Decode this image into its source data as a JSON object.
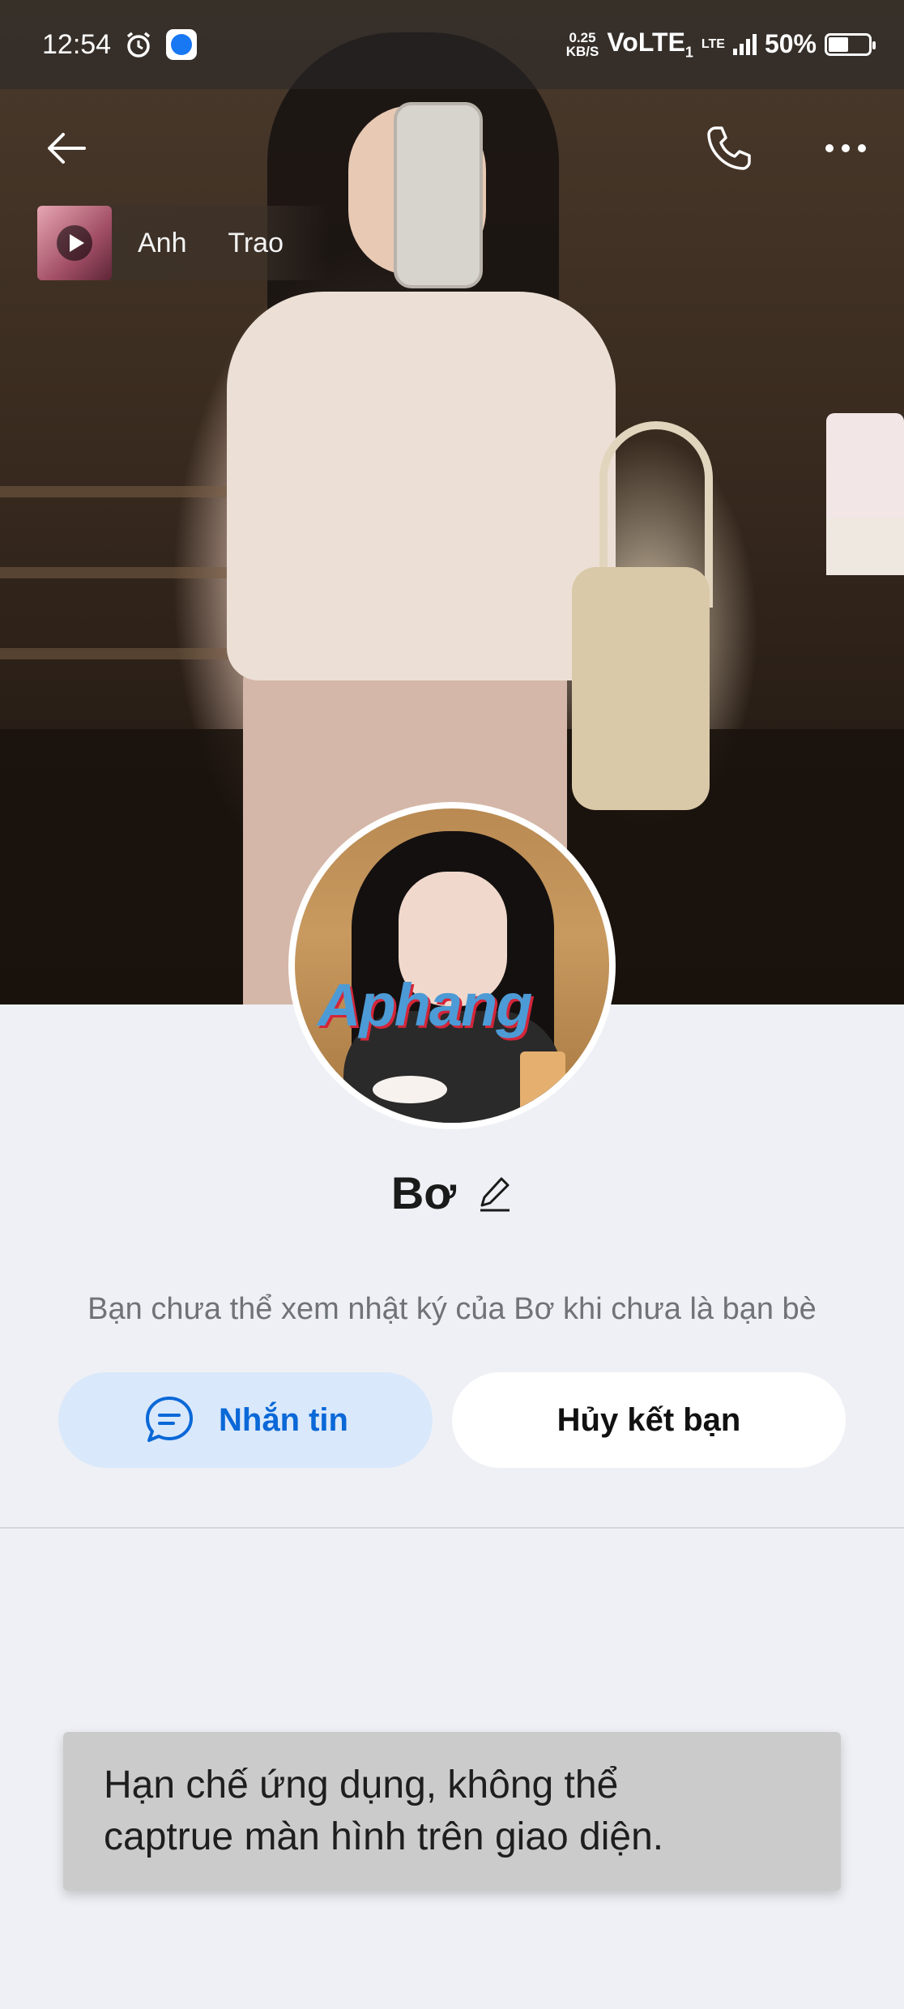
{
  "status_bar": {
    "time": "12:54",
    "net_speed_value": "0.25",
    "net_speed_unit": "KB/S",
    "network": "VoLTE",
    "network_sub": "1",
    "lte": "LTE",
    "battery": "50%",
    "battery_level": 0.5
  },
  "header": {
    "back_icon": "arrow-left-icon",
    "call_icon": "phone-icon",
    "more_icon": "more-dots-icon"
  },
  "music": {
    "text": "Anh Trao"
  },
  "profile": {
    "name": "Bơ",
    "watermark": "Aphang",
    "hint": "Bạn chưa thể xem nhật ký của Bơ khi chưa là bạn bè"
  },
  "actions": {
    "message_label": "Nhắn tin",
    "unfriend_label": "Hủy kết bạn"
  },
  "toast": {
    "line1": "Hạn chế ứng dụng, không thể",
    "line2": "captrue màn hình trên giao diện."
  },
  "colors": {
    "accent": "#0a68d7",
    "accent_bg": "#d9e8fb",
    "page_bg": "#eff0f5",
    "toast_bg": "#cbcbcb"
  }
}
